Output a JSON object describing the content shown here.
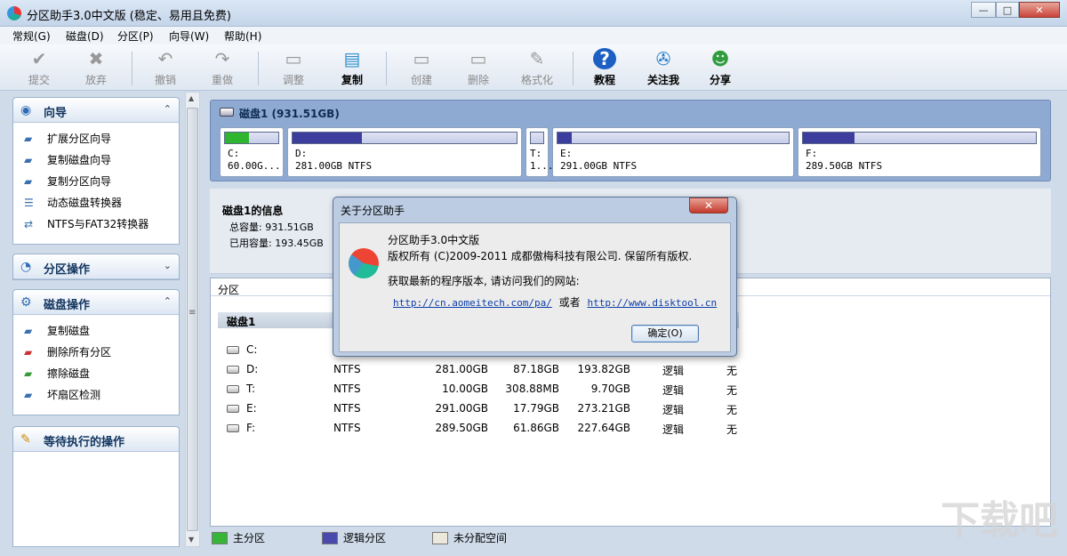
{
  "window": {
    "title": "分区助手3.0中文版 (稳定、易用且免费)",
    "minimize": "—",
    "maximize": "□",
    "close": "✕"
  },
  "menu": [
    {
      "label": "常规(G)"
    },
    {
      "label": "磁盘(D)"
    },
    {
      "label": "分区(P)"
    },
    {
      "label": "向导(W)"
    },
    {
      "label": "帮助(H)"
    }
  ],
  "toolbar": [
    {
      "label": "提交",
      "icon": "check-icon",
      "enabled": false
    },
    {
      "label": "放弃",
      "icon": "discard-icon",
      "enabled": false
    },
    {
      "label": "撤销",
      "icon": "undo-icon",
      "enabled": false
    },
    {
      "label": "重做",
      "icon": "redo-icon",
      "enabled": false
    },
    {
      "label": "调整",
      "icon": "resize-icon",
      "enabled": false
    },
    {
      "label": "复制",
      "icon": "copy-disk-icon",
      "enabled": true
    },
    {
      "label": "创建",
      "icon": "create-icon",
      "enabled": false
    },
    {
      "label": "删除",
      "icon": "delete-icon",
      "enabled": false
    },
    {
      "label": "格式化",
      "icon": "format-icon",
      "enabled": false
    },
    {
      "label": "教程",
      "icon": "help-icon",
      "enabled": true
    },
    {
      "label": "关注我",
      "icon": "follow-icon",
      "enabled": true
    },
    {
      "label": "分享",
      "icon": "share-icon",
      "enabled": true
    }
  ],
  "sidebar": {
    "wizard": {
      "title": "向导",
      "items": [
        "扩展分区向导",
        "复制磁盘向导",
        "复制分区向导",
        "动态磁盘转换器",
        "NTFS与FAT32转换器"
      ]
    },
    "partition_ops": {
      "title": "分区操作"
    },
    "disk_ops": {
      "title": "磁盘操作",
      "items": [
        "复制磁盘",
        "删除所有分区",
        "擦除磁盘",
        "坏扇区检测"
      ]
    },
    "pending": {
      "title": "等待执行的操作"
    }
  },
  "disk_map": {
    "title": "磁盘1  (931.51GB)",
    "partitions": [
      {
        "letter": "C:",
        "info": "60.00G...",
        "used_fraction": 0.45,
        "color": "#2fb52f"
      },
      {
        "letter": "D:",
        "info": "281.00GB NTFS",
        "used_fraction": 0.31,
        "color": "#3d3d9e"
      },
      {
        "letter": "T:",
        "info": "1...",
        "used_fraction": 0.0,
        "color": "#3d3d9e"
      },
      {
        "letter": "E:",
        "info": "291.00GB NTFS",
        "used_fraction": 0.06,
        "color": "#3d3d9e"
      },
      {
        "letter": "F:",
        "info": "289.50GB NTFS",
        "used_fraction": 0.22,
        "color": "#3d3d9e"
      }
    ]
  },
  "disk_info": {
    "title": "磁盘1的信息",
    "total": "总容量: 931.51GB",
    "used": "已用容量: 193.45GB"
  },
  "table": {
    "header": "分区",
    "disk_label": "磁盘1",
    "rows": [
      {
        "part": "C:",
        "fs": "",
        "cap": "",
        "used": "",
        "free": "",
        "type": "",
        "flag": ""
      },
      {
        "part": "D:",
        "fs": "NTFS",
        "cap": "281.00GB",
        "used": "87.18GB",
        "free": "193.82GB",
        "type": "逻辑",
        "flag": "无"
      },
      {
        "part": "T:",
        "fs": "NTFS",
        "cap": "10.00GB",
        "used": "308.88MB",
        "free": "9.70GB",
        "type": "逻辑",
        "flag": "无"
      },
      {
        "part": "E:",
        "fs": "NTFS",
        "cap": "291.00GB",
        "used": "17.79GB",
        "free": "273.21GB",
        "type": "逻辑",
        "flag": "无"
      },
      {
        "part": "F:",
        "fs": "NTFS",
        "cap": "289.50GB",
        "used": "61.86GB",
        "free": "227.64GB",
        "type": "逻辑",
        "flag": "无"
      }
    ]
  },
  "legend": [
    {
      "label": "主分区",
      "color": "#37b537"
    },
    {
      "label": "逻辑分区",
      "color": "#4a4aae"
    },
    {
      "label": "未分配空间",
      "color": "#ece8dc"
    }
  ],
  "about_dialog": {
    "title": "关于分区助手",
    "close": "✕",
    "line1": "分区助手3.0中文版",
    "line2": "版权所有 (C)2009-2011 成都傲梅科技有限公司. 保留所有版权.",
    "line3": "获取最新的程序版本, 请访问我们的网站:",
    "link1": "http://cn.aomeitech.com/pa/",
    "or": "或者",
    "link2": "http://www.disktool.cn",
    "ok": "确定(O)"
  }
}
